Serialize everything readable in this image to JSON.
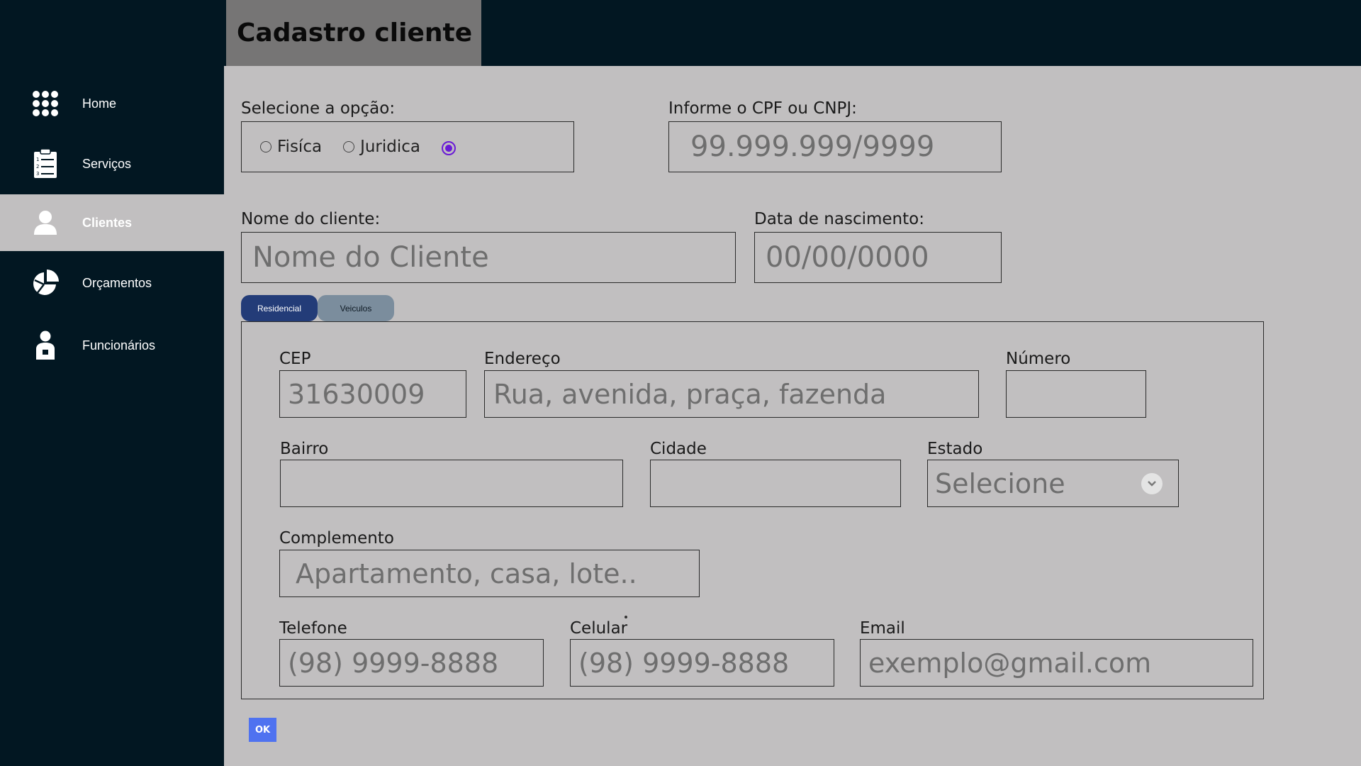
{
  "page": {
    "title": "Cadastro cliente"
  },
  "sidebar": {
    "items": [
      {
        "label": "Home",
        "icon": "grid-icon"
      },
      {
        "label": "Serviços",
        "icon": "clipboard-list-icon"
      },
      {
        "label": "Clientes",
        "icon": "user-icon",
        "active": true
      },
      {
        "label": "Orçamentos",
        "icon": "pie-chart-icon"
      },
      {
        "label": "Funcionários",
        "icon": "employee-badge-icon"
      }
    ]
  },
  "form": {
    "option_label": "Selecione a opção:",
    "options": [
      "Fisíca",
      "Juridica"
    ],
    "doc_label": "Informe o CPF ou CNPJ:",
    "doc_placeholder": "99.999.999/9999",
    "name_label": "Nome do cliente:",
    "name_placeholder": "Nome do Cliente",
    "birth_label": "Data de nascimento:",
    "birth_placeholder": "00/00/0000"
  },
  "tabs": {
    "active": "Residencial",
    "inactive": "Veiculos"
  },
  "address": {
    "cep_label": "CEP",
    "cep_placeholder": "31630009",
    "endereco_label": "Endereço",
    "endereco_placeholder": "Rua, avenida, praça, fazenda",
    "numero_label": "Número",
    "bairro_label": "Bairro",
    "cidade_label": "Cidade",
    "estado_label": "Estado",
    "estado_value": "Selecione",
    "complemento_label": "Complemento",
    "complemento_placeholder": "Apartamento, casa, lote..",
    "telefone_label": "Telefone",
    "telefone_placeholder": "(98) 9999-8888",
    "celular_label": "Celular",
    "celular_placeholder": "(98) 9999-8888",
    "email_label": "Email",
    "email_placeholder": "exemplo@gmail.com"
  },
  "actions": {
    "ok_label": "OK"
  },
  "colors": {
    "sidebar_bg": "#021722",
    "content_bg": "#c1bfc0",
    "title_bg": "#767575",
    "tab_active": "#233c78",
    "tab_inactive": "#7b8d9d",
    "radio_selected": "#6a1bd6",
    "ok_button": "#4f72f0"
  }
}
